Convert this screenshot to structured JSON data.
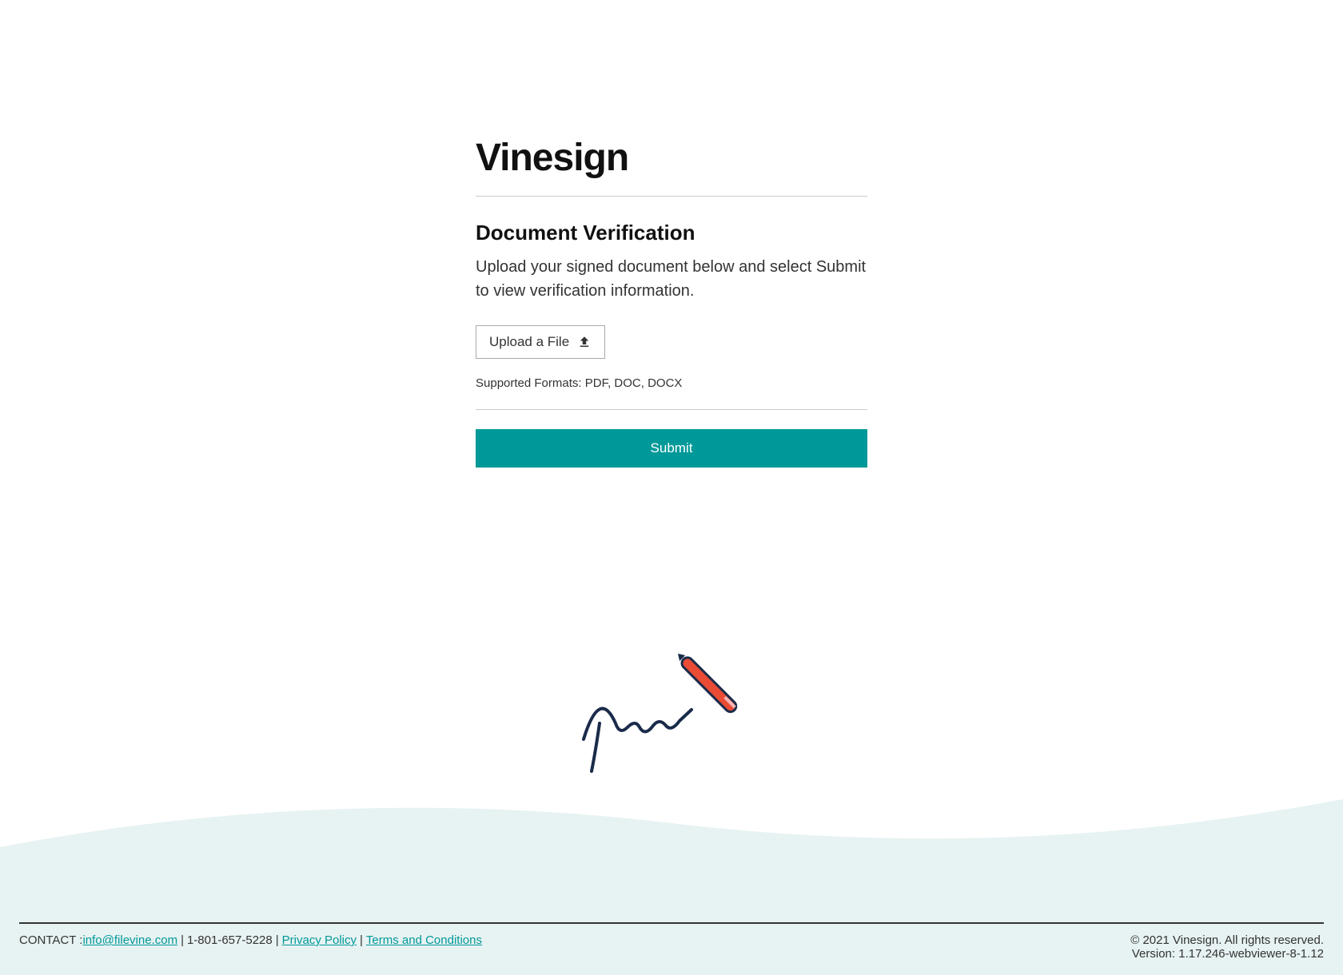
{
  "app": {
    "title": "Vinesign"
  },
  "main": {
    "heading": "Document Verification",
    "instruction": "Upload your signed document below and select Submit to view verification information.",
    "upload_label": "Upload a File",
    "supported_formats": "Supported Formats: PDF, DOC, DOCX",
    "submit_label": "Submit"
  },
  "footer": {
    "contact_label": "CONTACT : ",
    "email": "info@filevine.com",
    "phone": "1-801-657-5228",
    "privacy_label": "Privacy Policy",
    "terms_label": "Terms and Conditions",
    "copyright": "© 2021 Vinesign. All rights reserved.",
    "version": "Version: 1.17.246-webviewer-8-1.12"
  },
  "colors": {
    "accent": "#009999",
    "wave_bg": "#e7f2f2"
  }
}
